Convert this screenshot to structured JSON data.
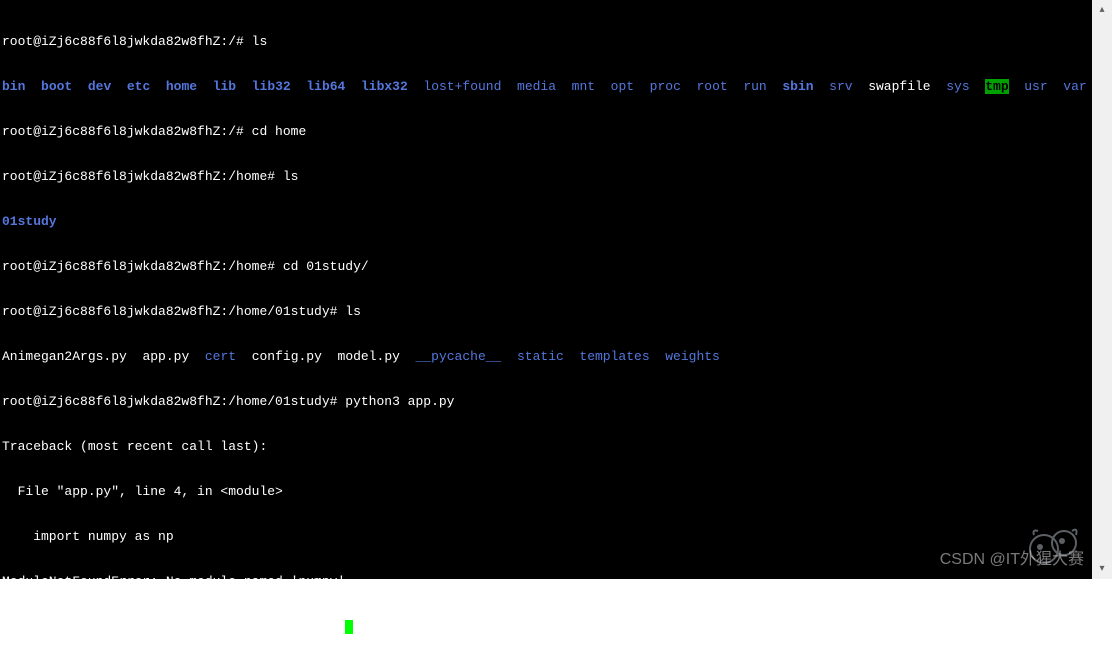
{
  "prompt1": "root@iZj6c88f6l8jwkda82w8fhZ:/# ",
  "cmd1": "ls",
  "root_ls": [
    {
      "t": "bin",
      "c": "blue bold"
    },
    {
      "t": "  ",
      "c": "white"
    },
    {
      "t": "boot",
      "c": "blue bold"
    },
    {
      "t": "  ",
      "c": "white"
    },
    {
      "t": "dev",
      "c": "blue bold"
    },
    {
      "t": "  ",
      "c": "white"
    },
    {
      "t": "etc",
      "c": "blue bold"
    },
    {
      "t": "  ",
      "c": "white"
    },
    {
      "t": "home",
      "c": "blue bold"
    },
    {
      "t": "  ",
      "c": "white"
    },
    {
      "t": "lib",
      "c": "blue bold"
    },
    {
      "t": "  ",
      "c": "white"
    },
    {
      "t": "lib32",
      "c": "blue bold"
    },
    {
      "t": "  ",
      "c": "white"
    },
    {
      "t": "lib64",
      "c": "blue bold"
    },
    {
      "t": "  ",
      "c": "white"
    },
    {
      "t": "libx32",
      "c": "blue bold"
    },
    {
      "t": "  ",
      "c": "white"
    },
    {
      "t": "lost+found",
      "c": "blue-normal"
    },
    {
      "t": "  ",
      "c": "white"
    },
    {
      "t": "media",
      "c": "blue-normal"
    },
    {
      "t": "  ",
      "c": "white"
    },
    {
      "t": "mnt",
      "c": "blue-normal"
    },
    {
      "t": "  ",
      "c": "white"
    },
    {
      "t": "opt",
      "c": "blue-normal"
    },
    {
      "t": "  ",
      "c": "white"
    },
    {
      "t": "proc",
      "c": "blue-normal"
    },
    {
      "t": "  ",
      "c": "white"
    },
    {
      "t": "root",
      "c": "blue-normal"
    },
    {
      "t": "  ",
      "c": "white"
    },
    {
      "t": "run",
      "c": "blue-normal"
    },
    {
      "t": "  ",
      "c": "white"
    },
    {
      "t": "sbin",
      "c": "blue bold"
    },
    {
      "t": "  ",
      "c": "white"
    },
    {
      "t": "srv",
      "c": "blue-normal"
    },
    {
      "t": "  ",
      "c": "white"
    },
    {
      "t": "swapfile",
      "c": "white"
    },
    {
      "t": "  ",
      "c": "white"
    },
    {
      "t": "sys",
      "c": "blue-normal"
    },
    {
      "t": "  ",
      "c": "white"
    },
    {
      "t": "tmp",
      "c": "green-hl"
    },
    {
      "t": "  ",
      "c": "white"
    },
    {
      "t": "usr",
      "c": "blue-normal"
    },
    {
      "t": "  ",
      "c": "white"
    },
    {
      "t": "var",
      "c": "blue-normal"
    }
  ],
  "cmd2": "cd home",
  "prompt_home": "root@iZj6c88f6l8jwkda82w8fhZ:/home# ",
  "cmd3": "ls",
  "home_ls": "01study",
  "cmd4": "cd 01study/",
  "prompt_study": "root@iZj6c88f6l8jwkda82w8fhZ:/home/01study# ",
  "cmd5": "ls",
  "study_ls": [
    {
      "t": "Animegan2Args.py",
      "c": "white"
    },
    {
      "t": "  ",
      "c": "white"
    },
    {
      "t": "app.py",
      "c": "white"
    },
    {
      "t": "  ",
      "c": "white"
    },
    {
      "t": "cert",
      "c": "blue-normal"
    },
    {
      "t": "  ",
      "c": "white"
    },
    {
      "t": "config.py",
      "c": "white"
    },
    {
      "t": "  ",
      "c": "white"
    },
    {
      "t": "model.py",
      "c": "white"
    },
    {
      "t": "  ",
      "c": "white"
    },
    {
      "t": "__pycache__",
      "c": "blue-normal"
    },
    {
      "t": "  ",
      "c": "white"
    },
    {
      "t": "static",
      "c": "blue-normal"
    },
    {
      "t": "  ",
      "c": "white"
    },
    {
      "t": "templates",
      "c": "blue-normal"
    },
    {
      "t": "  ",
      "c": "white"
    },
    {
      "t": "weights",
      "c": "blue-normal"
    }
  ],
  "cmd6": "python3 app.py",
  "traceback1": "Traceback (most recent call last):",
  "traceback2": "  File \"app.py\", line 4, in <module>",
  "traceback3": "    import numpy as np",
  "traceback4": "ModuleNotFoundError: No module named 'numpy'",
  "watermark": "CSDN @IT外猩大赛",
  "scrollbar": {
    "up": "▴",
    "down": "▾"
  }
}
